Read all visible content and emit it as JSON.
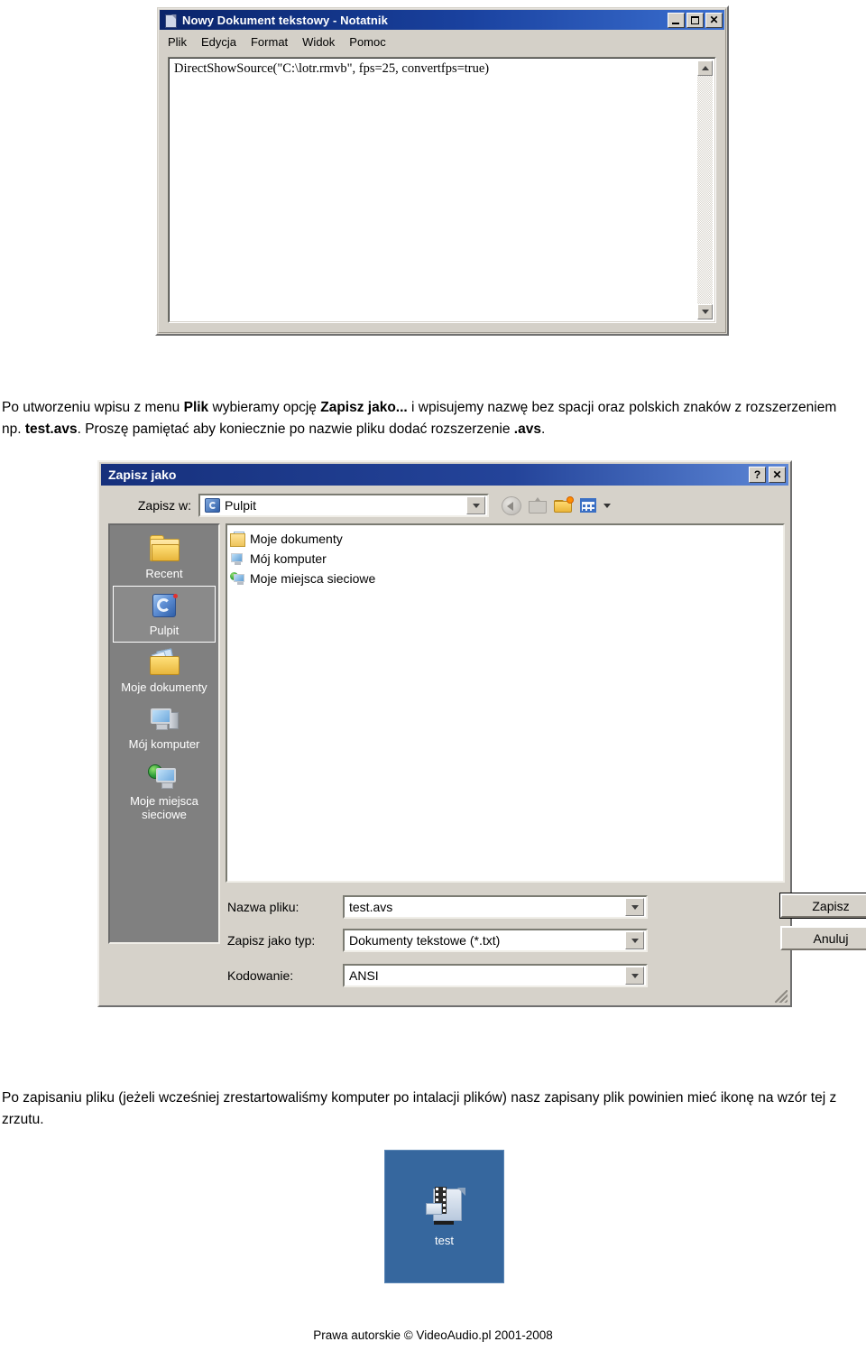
{
  "notepad": {
    "title": "Nowy Dokument tekstowy - Notatnik",
    "window_icon": "notepad-document-icon",
    "buttons": {
      "minimize": "minimize-button",
      "maximize": "maximize-button",
      "close": "close-button"
    },
    "menu": [
      "Plik",
      "Edycja",
      "Format",
      "Widok",
      "Pomoc"
    ],
    "content": "DirectShowSource(\"C:\\lotr.rmvb\", fps=25, convertfps=true)"
  },
  "paragraph1": {
    "p1": "Po utworzeniu wpisu z menu ",
    "b1": "Plik",
    "p2": " wybieramy opcję ",
    "b2": "Zapisz jako...",
    "p3": " i wpisujemy nazwę bez spacji oraz polskich znaków z rozszerzeniem np. ",
    "b3": "test.avs",
    "p4": ". Proszę pamiętać aby koniecznie po nazwie pliku dodać rozszerzenie ",
    "b4": ".avs",
    "p5": "."
  },
  "dialog": {
    "title": "Zapisz jako",
    "help_button": "?",
    "close_button": "✕",
    "lookin": {
      "label": "Zapisz w:",
      "label_underline": "a",
      "value": "Pulpit",
      "icon": "desktop-icon"
    },
    "toolbar": [
      {
        "name": "back-button",
        "label": "Wstecz"
      },
      {
        "name": "up-one-level-button",
        "label": "Do góry o jeden poziom"
      },
      {
        "name": "new-folder-button",
        "label": "Utwórz nowy folder"
      },
      {
        "name": "views-button",
        "label": "Widoki"
      }
    ],
    "places": [
      {
        "label": "Recent",
        "icon": "recent-folder-icon",
        "selected": false
      },
      {
        "label": "Pulpit",
        "icon": "desktop-icon",
        "selected": true
      },
      {
        "label": "Moje dokumenty",
        "icon": "my-documents-icon",
        "selected": false
      },
      {
        "label": "Mój komputer",
        "icon": "my-computer-icon",
        "selected": false
      },
      {
        "label": "Moje miejsca sieciowe",
        "icon": "network-places-icon",
        "selected": false
      }
    ],
    "files": [
      {
        "label": "Moje dokumenty",
        "icon": "my-documents-icon"
      },
      {
        "label": "Mój komputer",
        "icon": "my-computer-icon"
      },
      {
        "label": "Moje miejsca sieciowe",
        "icon": "network-places-icon"
      }
    ],
    "filename": {
      "label": "Nazwa pliku:",
      "value": "test.avs"
    },
    "filetype": {
      "label": "Zapisz jako typ:",
      "value": "Dokumenty tekstowe (*.txt)"
    },
    "encoding": {
      "label": "Kodowanie:",
      "value": "ANSI"
    },
    "save_button": "Zapisz",
    "cancel_button": "Anuluj"
  },
  "paragraph2": {
    "text": "Po zapisaniu pliku (jeżeli wcześniej zrestartowaliśmy komputer po intalacji plików) nasz zapisany plik powinien mieć ikonę na wzór tej z zrzutu."
  },
  "desktop_sample": {
    "icon": "avisynth-script-file-icon",
    "label": "test",
    "background_color": "#36679e"
  },
  "footer": {
    "text": "Prawa autorskie © VideoAudio.pl 2001-2008"
  }
}
